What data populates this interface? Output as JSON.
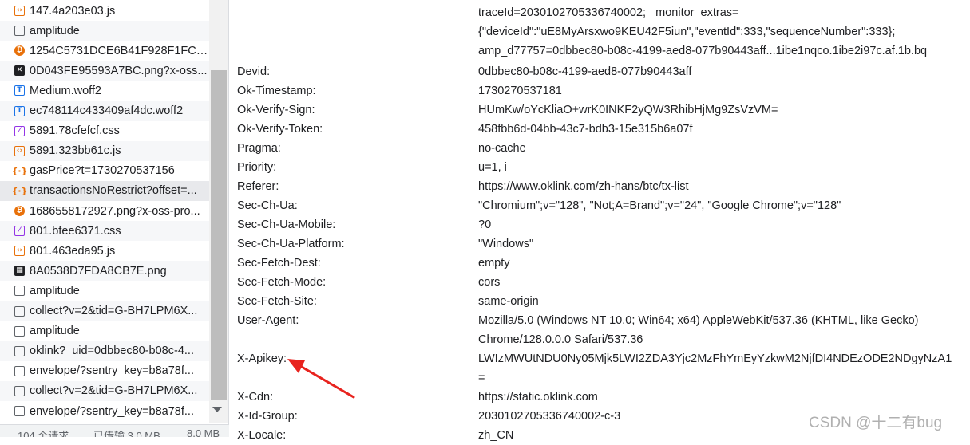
{
  "requests": [
    {
      "name": "147.4a203e03.js",
      "type": "script",
      "glyph": "‹›"
    },
    {
      "name": "amplitude",
      "type": "doc",
      "glyph": ""
    },
    {
      "name": "1254C5731DCE6B41F928F1FC5...",
      "type": "img",
      "glyph": "₿"
    },
    {
      "name": "0D043FE95593A7BC.png?x-oss...",
      "type": "imgdark",
      "glyph": "✕"
    },
    {
      "name": "Medium.woff2",
      "type": "font",
      "glyph": "T"
    },
    {
      "name": "ec748114c433409af4dc.woff2",
      "type": "font",
      "glyph": "T"
    },
    {
      "name": "5891.78cfefcf.css",
      "type": "css",
      "glyph": "⁄"
    },
    {
      "name": "5891.323bb61c.js",
      "type": "script",
      "glyph": "‹›"
    },
    {
      "name": "gasPrice?t=1730270537156",
      "type": "fetch",
      "glyph": "{·}"
    },
    {
      "name": "transactionsNoRestrict?offset=...",
      "type": "fetch",
      "glyph": "{·}"
    },
    {
      "name": "1686558172927.png?x-oss-pro...",
      "type": "img",
      "glyph": "₿"
    },
    {
      "name": "801.bfee6371.css",
      "type": "css",
      "glyph": "⁄"
    },
    {
      "name": "801.463eda95.js",
      "type": "script",
      "glyph": "‹›"
    },
    {
      "name": "8A0538D7FDA8CB7E.png",
      "type": "imgdark",
      "glyph": "▦"
    },
    {
      "name": "amplitude",
      "type": "doc",
      "glyph": ""
    },
    {
      "name": "collect?v=2&tid=G-BH7LPM6X...",
      "type": "doc",
      "glyph": ""
    },
    {
      "name": "amplitude",
      "type": "doc",
      "glyph": ""
    },
    {
      "name": "oklink?_uid=0dbbec80-b08c-4...",
      "type": "doc",
      "glyph": ""
    },
    {
      "name": "envelope/?sentry_key=b8a78f...",
      "type": "doc",
      "glyph": ""
    },
    {
      "name": "collect?v=2&tid=G-BH7LPM6X...",
      "type": "doc",
      "glyph": ""
    },
    {
      "name": "envelope/?sentry_key=b8a78f...",
      "type": "doc",
      "glyph": ""
    }
  ],
  "selected_request_index": 9,
  "status": {
    "requests": "104 个请求",
    "transferred": "已传输 3.0 MB",
    "resources": "8.0 MB"
  },
  "cookie_continuation": [
    "traceId=2030102705336740002; _monitor_extras=",
    "{\"deviceId\":\"uE8MyArsxwo9KEU42F5iun\",\"eventId\":333,\"sequenceNumber\":333};",
    "amp_d77757=0dbbec80-b08c-4199-aed8-077b90443aff...1ibe1nqco.1ibe2i97c.af.1b.bq"
  ],
  "headers": [
    {
      "key": "Devid:",
      "value": "0dbbec80-b08c-4199-aed8-077b90443aff"
    },
    {
      "key": "Ok-Timestamp:",
      "value": "1730270537181"
    },
    {
      "key": "Ok-Verify-Sign:",
      "value": "HUmKw/oYcKliaO+wrK0INKF2yQW3RhibHjMg9ZsVzVM="
    },
    {
      "key": "Ok-Verify-Token:",
      "value": "458fbb6d-04bb-43c7-bdb3-15e315b6a07f"
    },
    {
      "key": "Pragma:",
      "value": "no-cache"
    },
    {
      "key": "Priority:",
      "value": "u=1, i"
    },
    {
      "key": "Referer:",
      "value": "https://www.oklink.com/zh-hans/btc/tx-list"
    },
    {
      "key": "Sec-Ch-Ua:",
      "value": "\"Chromium\";v=\"128\", \"Not;A=Brand\";v=\"24\", \"Google Chrome\";v=\"128\""
    },
    {
      "key": "Sec-Ch-Ua-Mobile:",
      "value": "?0"
    },
    {
      "key": "Sec-Ch-Ua-Platform:",
      "value": "\"Windows\""
    },
    {
      "key": "Sec-Fetch-Dest:",
      "value": "empty"
    },
    {
      "key": "Sec-Fetch-Mode:",
      "value": "cors"
    },
    {
      "key": "Sec-Fetch-Site:",
      "value": "same-origin"
    },
    {
      "key": "User-Agent:",
      "value": "Mozilla/5.0 (Windows NT 10.0; Win64; x64) AppleWebKit/537.36 (KHTML, like Gecko)",
      "value_cont": "Chrome/128.0.0.0 Safari/537.36"
    },
    {
      "key": "X-Apikey:",
      "value": "LWIzMWUtNDU0Ny05Mjk5LWI2ZDA3Yjc2MzFhYmEyYzkwM2NjfDI4NDEzODE2NDgyNzA1",
      "value_cont": "="
    },
    {
      "key": "X-Cdn:",
      "value": "https://static.oklink.com"
    },
    {
      "key": "X-Id-Group:",
      "value": "2030102705336740002-c-3"
    },
    {
      "key": "X-Locale:",
      "value": "zh_CN"
    }
  ],
  "watermark": "CSDN @十二有bug",
  "colors": {
    "arrow": "#e8231e",
    "script": "#e8710a",
    "font": "#1a73e8",
    "css": "#9334e6"
  }
}
